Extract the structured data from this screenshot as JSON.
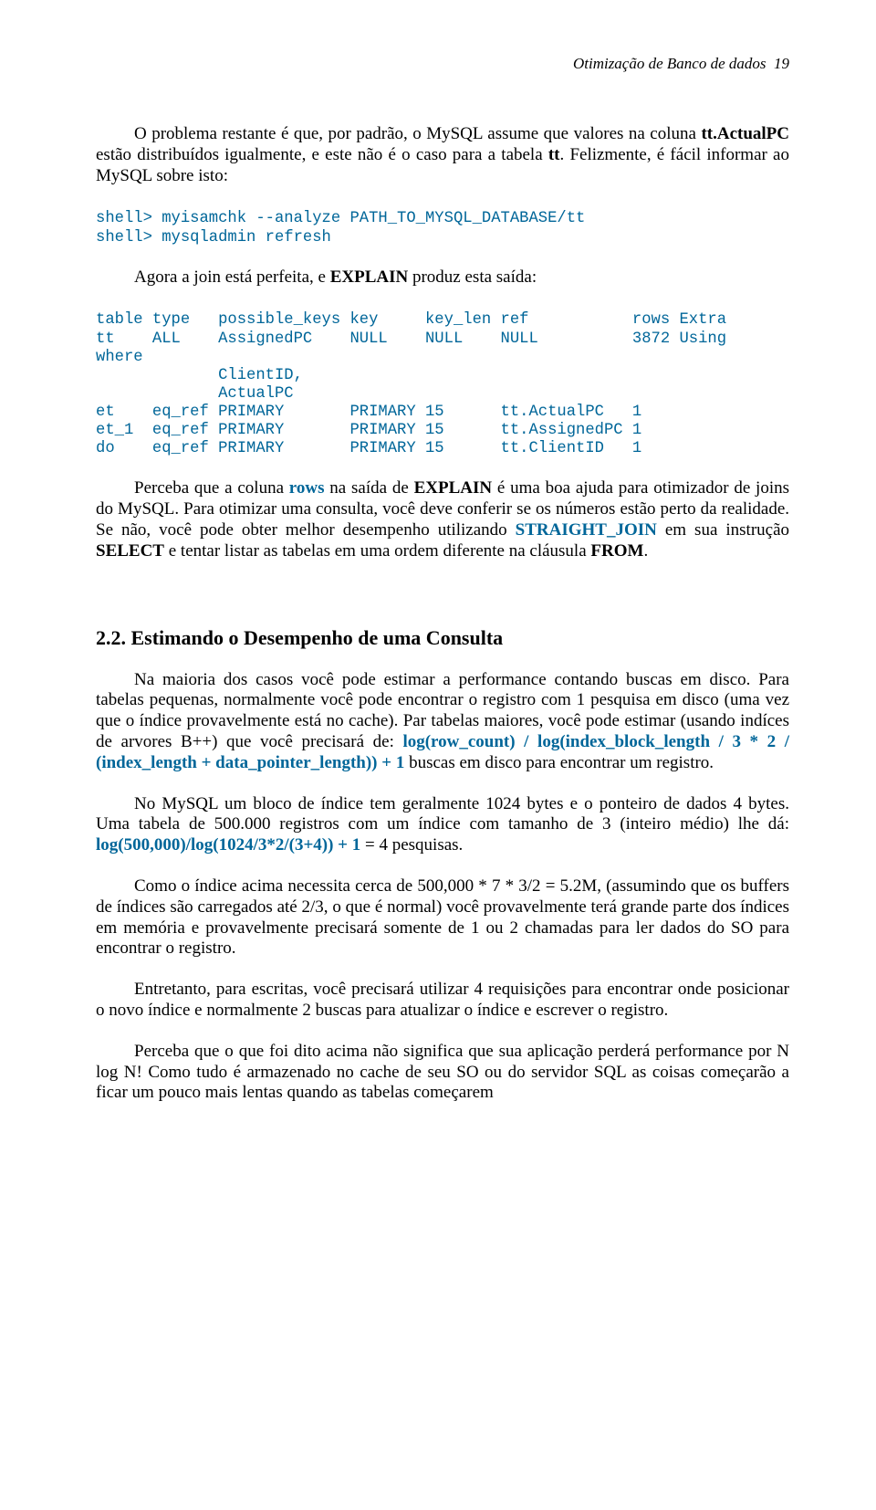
{
  "header": {
    "title": "Otimização de Banco de dados",
    "page_number": "19"
  },
  "p1_a": "O problema restante é que, por padrão, o MySQL assume que valores na coluna ",
  "p1_b": "tt.ActualPC",
  "p1_c": " estão distribuídos igualmente, e este não é o caso para a tabela ",
  "p1_d": "tt",
  "p1_e": ". Felizmente, é fácil informar ao MySQL sobre isto:",
  "code1": "shell> myisamchk --analyze PATH_TO_MYSQL_DATABASE/tt\nshell> mysqladmin refresh",
  "p2_a": "Agora a join está perfeita, e ",
  "p2_b": "EXPLAIN",
  "p2_c": " produz esta saída:",
  "code2": "table type   possible_keys key     key_len ref           rows Extra\ntt    ALL    AssignedPC    NULL    NULL    NULL          3872 Using\nwhere\n             ClientID,\n             ActualPC\net    eq_ref PRIMARY       PRIMARY 15      tt.ActualPC   1\net_1  eq_ref PRIMARY       PRIMARY 15      tt.AssignedPC 1\ndo    eq_ref PRIMARY       PRIMARY 15      tt.ClientID   1",
  "p3_a": "Perceba que a coluna ",
  "p3_b": "rows",
  "p3_c": " na saída de ",
  "p3_d": "EXPLAIN",
  "p3_e": " é uma boa ajuda para otimizador de joins do MySQL. Para otimizar uma consulta, você deve conferir se os números estão perto da realidade. Se não, você pode obter melhor desempenho utilizando ",
  "p3_f": "STRAIGHT_JOIN",
  "p3_g": " em sua instrução ",
  "p3_h": "SELECT",
  "p3_i": " e tentar listar as tabelas em uma ordem diferente na cláusula ",
  "p3_j": "FROM",
  "p3_k": ".",
  "section_heading": "2.2. Estimando o Desempenho de uma Consulta",
  "p4_a": "Na maioria dos casos você pode estimar a performance contando buscas em disco. Para tabelas pequenas, normalmente você pode encontrar o registro com 1 pesquisa em disco (uma vez que o índice provavelmente está no cache). Par tabelas maiores, você pode estimar (usando indíces de arvores B++) que você precisará de: ",
  "p4_b": "log(row_count) / log(index_block_length / 3 * 2 / (index_length + data_pointer_length)) + 1",
  "p4_c": " buscas em disco para encontrar um registro.",
  "p5_a": "No MySQL um bloco de índice tem geralmente 1024 bytes e o ponteiro de dados 4 bytes. Uma tabela de 500.000 registros com um índice com tamanho de 3 (inteiro médio) lhe dá: ",
  "p5_b": "log(500,000)/log(1024/3*2/(3+4)) + 1",
  "p5_c": " = 4 pesquisas.",
  "p6": "Como o índice acima necessita cerca de 500,000 * 7 * 3/2 = 5.2M, (assumindo que os buffers de índices são carregados até 2/3, o que é normal) você provavelmente terá grande parte dos índices em memória e provavelmente precisará somente de 1 ou 2 chamadas para ler dados do SO para encontrar o registro.",
  "p7": "Entretanto, para escritas, você precisará utilizar 4 requisições para encontrar onde posicionar o novo índice e normalmente 2 buscas para atualizar o índice e escrever o registro.",
  "p8": "Perceba que o que foi dito acima não significa que sua aplicação perderá performance por N log N! Como tudo é armazenado no cache de seu SO ou do servidor SQL as coisas começarão a ficar um pouco mais lentas quando as tabelas começarem"
}
